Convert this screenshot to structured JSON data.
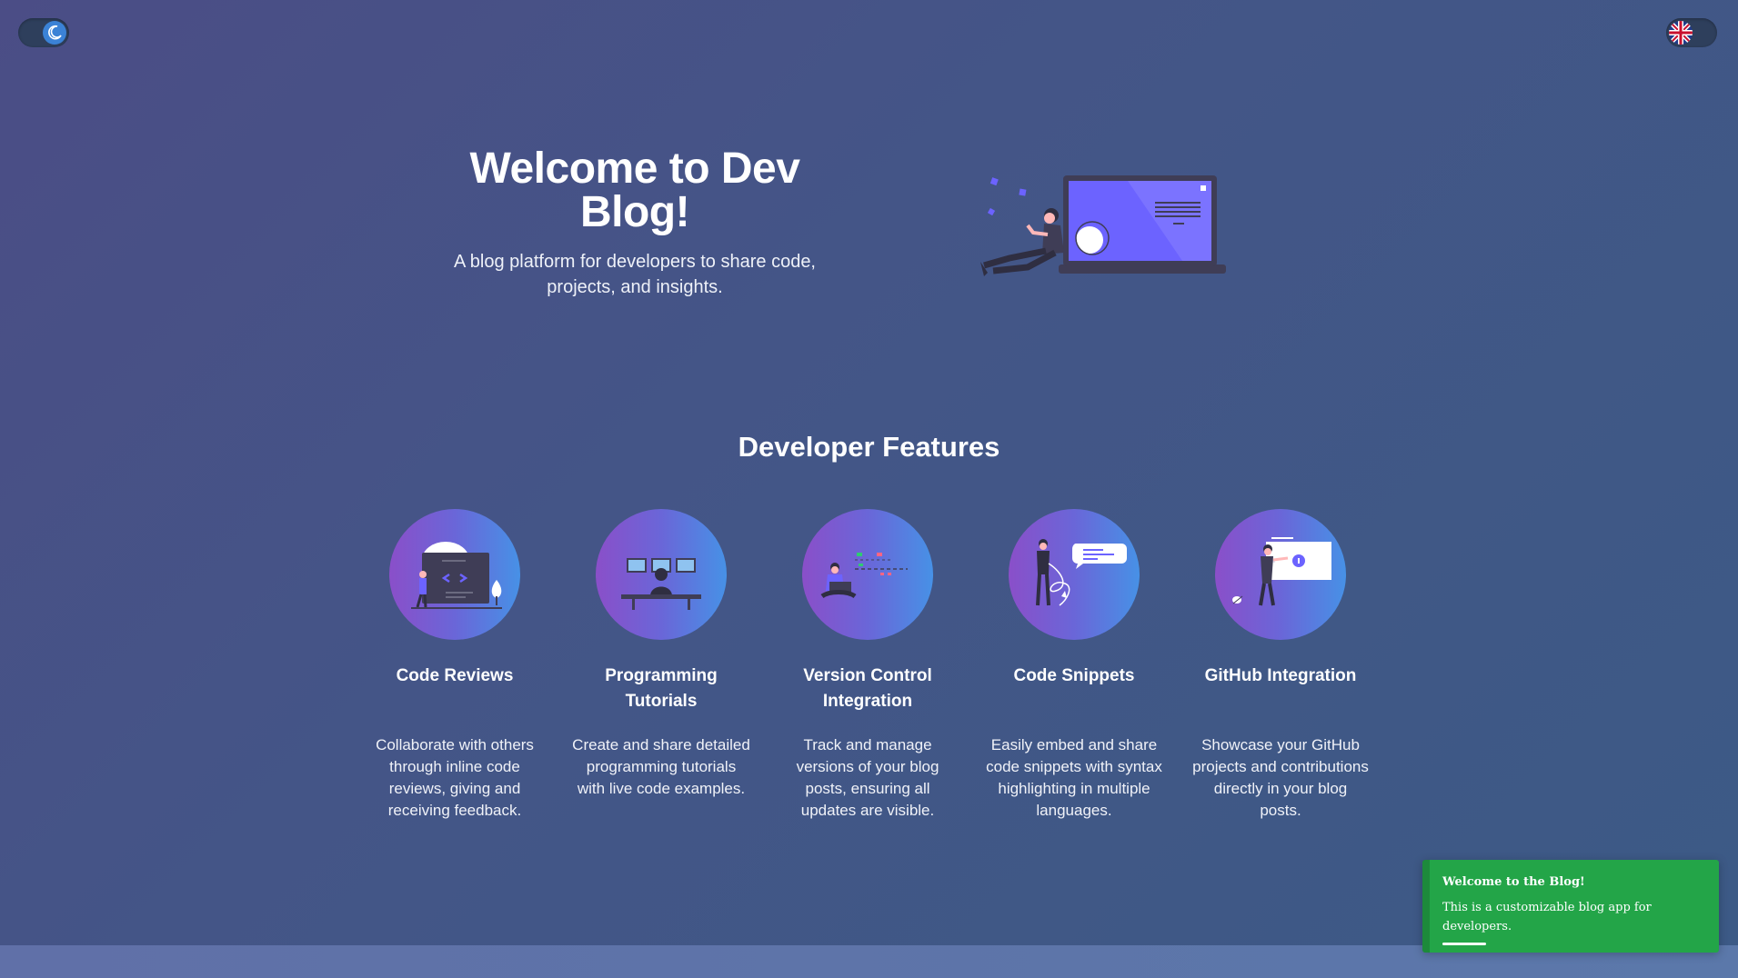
{
  "header": {
    "theme_toggle_icon": "moon-icon",
    "language_toggle_icon": "uk-flag-icon"
  },
  "hero": {
    "title": "Welcome to Dev Blog!",
    "subtitle": "A blog platform for developers to share code, projects, and insights.",
    "illustration": "developer-laptop-illustration"
  },
  "features": {
    "heading": "Developer Features",
    "items": [
      {
        "title": "Code Reviews",
        "description": "Collaborate with others through inline code reviews, giving and receiving feedback.",
        "icon": "code-review-illustration"
      },
      {
        "title": "Programming Tutorials",
        "description": "Create and share detailed programming tutorials with live code examples.",
        "icon": "programming-tutorials-illustration"
      },
      {
        "title": "Version Control Integration",
        "description": "Track and manage versions of your blog posts, ensuring all updates are visible.",
        "icon": "version-control-illustration"
      },
      {
        "title": "Code Snippets",
        "description": "Easily embed and share code snippets with syntax highlighting in multiple languages.",
        "icon": "code-snippets-illustration"
      },
      {
        "title": "GitHub Integration",
        "description": "Showcase your GitHub projects and contributions directly in your blog posts.",
        "icon": "github-integration-illustration"
      }
    ]
  },
  "toast": {
    "title": "Welcome to the Blog!",
    "message": "This is a customizable blog app for developers.",
    "color": "#23a548"
  },
  "colors": {
    "accent": "#6c63ff",
    "background_start": "#4b4d86",
    "background_end": "#3c5a86"
  }
}
